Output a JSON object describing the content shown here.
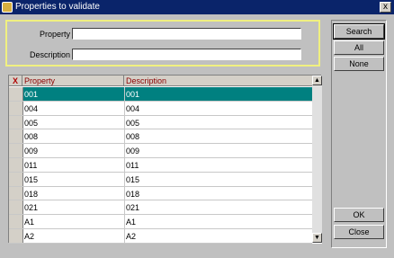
{
  "window": {
    "title": "Properties to validate",
    "close_glyph": "x"
  },
  "filter": {
    "property_label": "Property",
    "property_value": "",
    "description_label": "Description",
    "description_value": ""
  },
  "grid": {
    "header": {
      "x": "X",
      "property": "Property",
      "description": "Description"
    },
    "rows": [
      {
        "property": "001",
        "description": "001",
        "selected": true
      },
      {
        "property": "004",
        "description": "004"
      },
      {
        "property": "005",
        "description": "005"
      },
      {
        "property": "008",
        "description": "008"
      },
      {
        "property": "009",
        "description": "009"
      },
      {
        "property": "011",
        "description": "011"
      },
      {
        "property": "015",
        "description": "015"
      },
      {
        "property": "018",
        "description": "018"
      },
      {
        "property": "021",
        "description": "021"
      },
      {
        "property": "A1",
        "description": "A1"
      },
      {
        "property": "A2",
        "description": "A2"
      }
    ]
  },
  "buttons": {
    "search": "Search",
    "all": "All",
    "none": "None",
    "ok": "OK",
    "close": "Close"
  }
}
